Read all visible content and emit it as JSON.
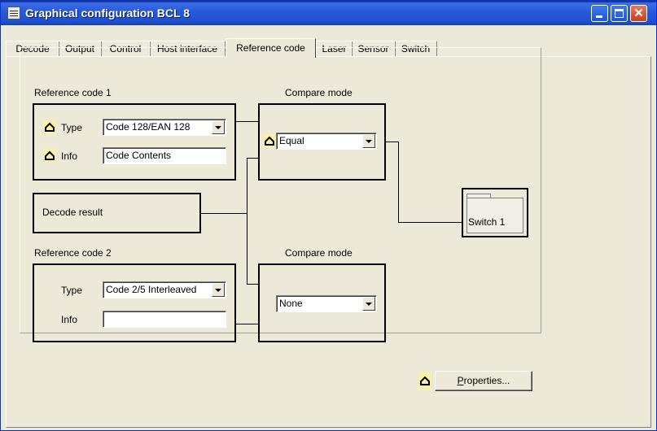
{
  "window": {
    "title": "Graphical configuration BCL 8"
  },
  "tabs": [
    {
      "label": "Decode"
    },
    {
      "label": "Output"
    },
    {
      "label": "Control"
    },
    {
      "label": "Host interface"
    },
    {
      "label": "Reference code"
    },
    {
      "label": "Laser"
    },
    {
      "label": "Sensor"
    },
    {
      "label": "Switch"
    }
  ],
  "active_tab": "Reference code",
  "reference_code_1": {
    "heading": "Reference code 1",
    "type_label": "Type",
    "type_value": "Code 128/EAN 128",
    "info_label": "Info",
    "info_value": "Code Contents"
  },
  "compare_mode_1": {
    "heading": "Compare mode",
    "value": "Equal"
  },
  "decode_result": {
    "label": "Decode result"
  },
  "reference_code_2": {
    "heading": "Reference code 2",
    "type_label": "Type",
    "type_value": "Code 2/5 Interleaved",
    "info_label": "Info",
    "info_value": ""
  },
  "compare_mode_2": {
    "heading": "Compare mode",
    "value": "None"
  },
  "switch_target": {
    "label": "Switch 1"
  },
  "properties_button": {
    "label_underlined": "P",
    "label_rest": "roperties..."
  },
  "icons": {
    "lock_marker": "modified-indicator-icon",
    "accent_highlight": "#f6f0a8"
  }
}
